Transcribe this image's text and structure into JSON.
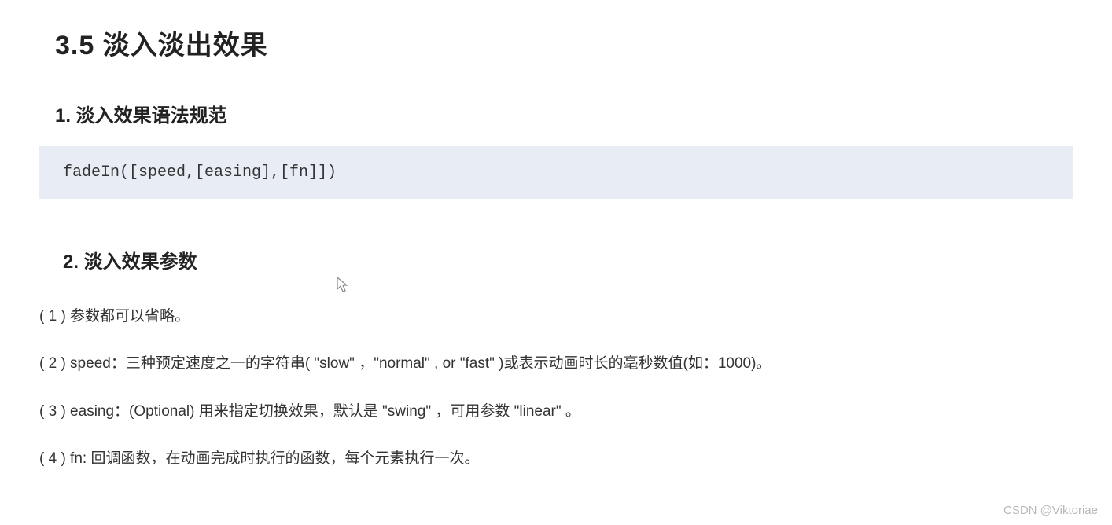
{
  "heading": "3.5  淡入淡出效果",
  "section1_title": "1. 淡入效果语法规范",
  "code": "fadeIn([speed,[easing],[fn]])",
  "section2_title": "2. 淡入效果参数",
  "params": [
    "( 1 ) 参数都可以省略。",
    "( 2 ) speed：三种预定速度之一的字符串( \"slow\" ，\"normal\" , or  \"fast\" )或表示动画时长的毫秒数值(如：1000)。",
    "( 3 ) easing：(Optional) 用来指定切换效果，默认是 \"swing\" ，可用参数 \"linear\" 。",
    "( 4 ) fn: 回调函数，在动画完成时执行的函数，每个元素执行一次。"
  ],
  "watermark": "CSDN @Viktoriae"
}
